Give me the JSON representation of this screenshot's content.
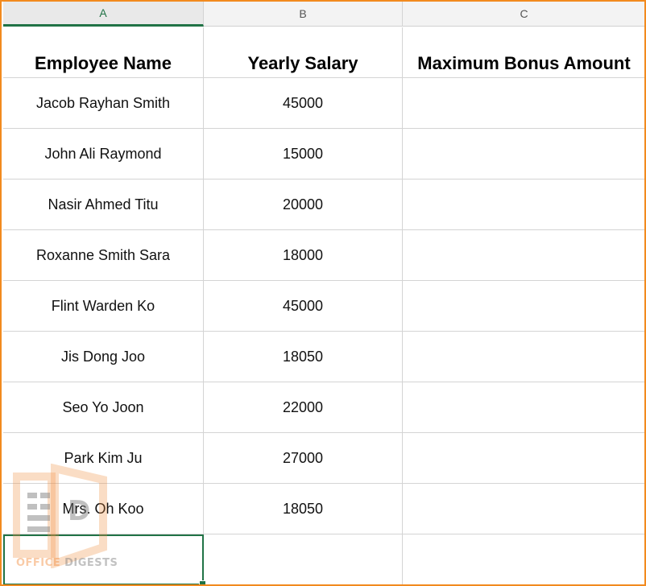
{
  "columns": [
    {
      "letter": "A",
      "selected": true
    },
    {
      "letter": "B",
      "selected": false
    },
    {
      "letter": "C",
      "selected": false
    }
  ],
  "table": {
    "headers": [
      "Employee Name",
      "Yearly Salary",
      "Maximum Bonus Amount"
    ],
    "rows": [
      {
        "name": "Jacob Rayhan Smith",
        "salary": "45000",
        "bonus": ""
      },
      {
        "name": "John Ali Raymond",
        "salary": "15000",
        "bonus": ""
      },
      {
        "name": "Nasir Ahmed Titu",
        "salary": "20000",
        "bonus": ""
      },
      {
        "name": "Roxanne Smith Sara",
        "salary": "18000",
        "bonus": ""
      },
      {
        "name": "Flint Warden Ko",
        "salary": "45000",
        "bonus": ""
      },
      {
        "name": "Jis Dong Joo",
        "salary": "18050",
        "bonus": ""
      },
      {
        "name": "Seo Yo Joon",
        "salary": "22000",
        "bonus": ""
      },
      {
        "name": "Park Kim Ju",
        "salary": "27000",
        "bonus": ""
      },
      {
        "name": "Mrs. Oh Koo",
        "salary": "18050",
        "bonus": ""
      }
    ]
  },
  "watermark": {
    "word1": "OFFICE",
    "word2": "DIGESTS",
    "letter": "D"
  },
  "colors": {
    "selection": "#217346",
    "frame": "#f28a1e"
  }
}
